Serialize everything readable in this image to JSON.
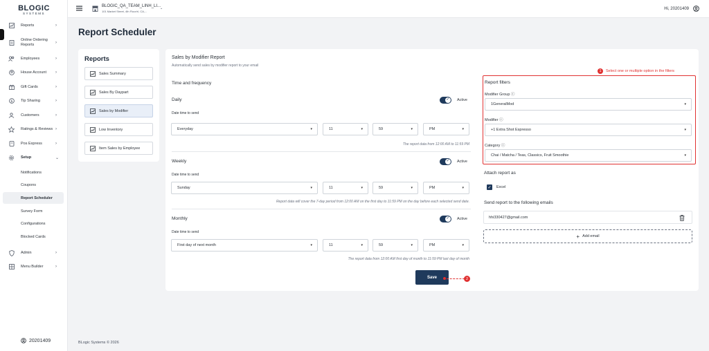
{
  "brand": {
    "name": "BLOGIC",
    "sub": "SYSTEMS"
  },
  "sidebar": {
    "items": [
      {
        "label": "Reports",
        "icon": "chart-icon",
        "chevron": "›"
      },
      {
        "label": "Online Ordering Reports",
        "icon": "document-icon",
        "chevron": "›"
      },
      {
        "label": "Employees",
        "icon": "people-icon",
        "chevron": "›"
      },
      {
        "label": "House Account",
        "icon": "user-circle-icon",
        "chevron": "›"
      },
      {
        "label": "Gift Cards",
        "icon": "gift-icon",
        "chevron": "›"
      },
      {
        "label": "Tip Sharing",
        "icon": "tip-icon",
        "chevron": "›"
      },
      {
        "label": "Customers",
        "icon": "customers-icon",
        "chevron": "›"
      },
      {
        "label": "Ratings & Reviews",
        "icon": "star-icon",
        "chevron": "›"
      },
      {
        "label": "Pos Express",
        "icon": "pos-icon",
        "chevron": "›"
      },
      {
        "label": "Setup",
        "icon": "gear-icon",
        "chevron": "⌄"
      }
    ],
    "setup_sub": [
      "Notifications",
      "Coupons",
      "Report Scheduler",
      "Survey Form",
      "Configurations",
      "Blocked Cards"
    ],
    "bottom_items": [
      {
        "label": "Admin",
        "icon": "shield-icon",
        "chevron": "›"
      },
      {
        "label": "Menu Builder",
        "icon": "menu-builder-icon",
        "chevron": "›"
      }
    ],
    "user": "20201409"
  },
  "header": {
    "store_name": "BLOGIC_QA_TEAM_LINH_LI...",
    "store_address": "101 Market Street, 4th Floor/rl, CA,...",
    "greeting": "Hi, 20201409"
  },
  "page_title": "Report Scheduler",
  "reports": {
    "title": "Reports",
    "items": [
      "Sales Summary",
      "Sales By Daypart",
      "Sales by Modifier",
      "Low Inventory",
      "Item Sales by Employee"
    ],
    "active_index": 2
  },
  "report": {
    "title": "Sales by Modifier Report",
    "subtitle": "Automatically send sales by modifier report to your email",
    "time_heading": "Time and frequency",
    "date_time_label": "Date time to send",
    "active_label": "Active",
    "daily": {
      "title": "Daily",
      "day": "Everyday",
      "hour": "11",
      "minute": "59",
      "ampm": "PM",
      "note": "The report data from 12:00 AM to 11:59 PM"
    },
    "weekly": {
      "title": "Weekly",
      "day": "Sunday",
      "hour": "11",
      "minute": "59",
      "ampm": "PM",
      "note": "Report data will cover the 7-day period from 12:00 AM on the first day to 11:59 PM on the day before each selected send date."
    },
    "monthly": {
      "title": "Monthly",
      "day": "First day of next month",
      "hour": "11",
      "minute": "59",
      "ampm": "PM",
      "note": "The report data from 12:00 AM first day of month to 11:59 PM last day of month"
    },
    "save_label": "Save"
  },
  "filters": {
    "hint_number": "1",
    "hint": "Select one or multiple option in the filters",
    "title": "Report filters",
    "modifier_group_label": "Modifier Group",
    "modifier_group_value": "1GeneralMod",
    "modifier_label": "Modifier",
    "modifier_value": "+1 Extra Shot Espresso",
    "category_label": "Category",
    "category_value": "Chai / Matcha / Teas, Classics, Fruit Smoothie"
  },
  "attach": {
    "title": "Attach report as",
    "excel_label": "Excel"
  },
  "emails": {
    "title": "Send report to the following emails",
    "list": [
      "hhi330427@gmail.com"
    ],
    "add_label": "Add email"
  },
  "save_badge": "2",
  "footer": "BLogic Systems © 2026"
}
